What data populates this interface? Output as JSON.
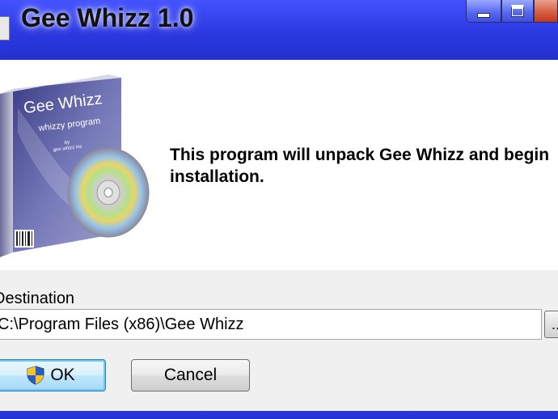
{
  "window": {
    "title": "Gee Whizz 1.0",
    "controls": [
      "minimize-icon",
      "maximize-icon",
      "close-icon"
    ]
  },
  "banner": {
    "message": "This program will unpack Gee Whizz and begin installation.",
    "box_art": {
      "product_name": "Gee Whizz",
      "tagline": "whizzy program",
      "by_line": "by",
      "publisher": "gee whizz inc"
    }
  },
  "destination": {
    "label": "Destination",
    "value": "C:\\Program Files (x86)\\Gee Whizz",
    "browse_label": "..."
  },
  "buttons": {
    "ok": "OK",
    "cancel": "Cancel"
  },
  "icons": {
    "ok_button_icon": "uac-shield-icon"
  },
  "colors": {
    "titlebar": "#2c38e0",
    "dialog_bg": "#f0f0f0",
    "banner_bg": "#ffffff",
    "default_button_border": "#3c7fb1"
  }
}
